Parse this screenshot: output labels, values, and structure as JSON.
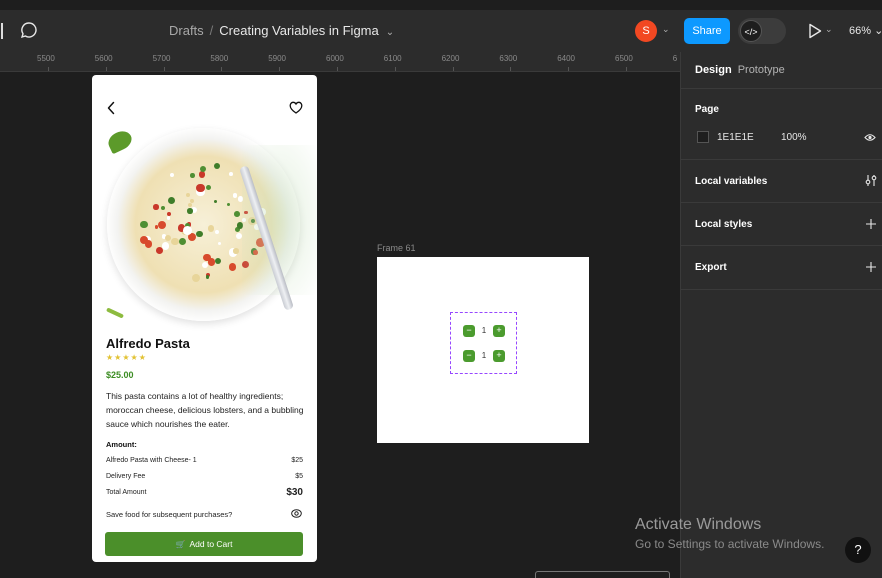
{
  "topbar": {
    "breadcrumb_root": "Drafts",
    "breadcrumb_sep": "/",
    "file_name": "Creating Variables in Figma",
    "avatar_initial": "S",
    "share_label": "Share",
    "dev_mode_glyph": "</>",
    "zoom_label": "66%"
  },
  "ruler": {
    "ticks": [
      "5500",
      "5600",
      "5700",
      "5800",
      "5900",
      "6000",
      "6100",
      "6200",
      "6300",
      "6400",
      "6500",
      "6"
    ]
  },
  "right_panel": {
    "tab_design": "Design",
    "tab_prototype": "Prototype",
    "page_title": "Page",
    "page_bg_hex": "1E1E1E",
    "page_bg_opacity": "100%",
    "local_variables": "Local variables",
    "local_styles": "Local styles",
    "export": "Export"
  },
  "canvas": {
    "frame_label": "Frame 61",
    "steppers": [
      {
        "minus": "−",
        "value": "1",
        "plus": "+"
      },
      {
        "minus": "−",
        "value": "1",
        "plus": "+"
      }
    ]
  },
  "product_card": {
    "title": "Alfredo Pasta",
    "stars": "★★★★★",
    "rating": 5,
    "price": "$25.00",
    "description": "This pasta contains a lot of healthy ingredients; moroccan cheese, delicious lobsters, and a bubbling sauce which nourishes the eater.",
    "amount_label": "Amount:",
    "line_items": [
      {
        "label": "Alfredo Pasta with Cheese- 1",
        "value": "$25"
      },
      {
        "label": "Delivery Fee",
        "value": "$5"
      },
      {
        "label": "Total Amount",
        "value": "$30"
      }
    ],
    "save_prompt": "Save food for subsequent purchases?",
    "cart_glyph": "🛒",
    "cart_button": "Add to Cart"
  },
  "watermark": {
    "title": "Activate Windows",
    "subtitle": "Go to Settings to activate Windows."
  },
  "help_label": "?",
  "colors": {
    "canvas_bg": "#1E1E1E",
    "chrome_bg": "#2c2c2c",
    "share_blue": "#0d99ff",
    "avatar_red": "#f24822",
    "accent_green": "#4b8f2a",
    "selection_purple": "#9747ff"
  },
  "icons": [
    "comment-icon",
    "chevron-down-icon",
    "code-icon",
    "play-icon",
    "eye-icon",
    "variables-icon",
    "plus-icon",
    "back-arrow-icon",
    "heart-icon",
    "cart-icon",
    "minus-icon",
    "help-icon"
  ]
}
